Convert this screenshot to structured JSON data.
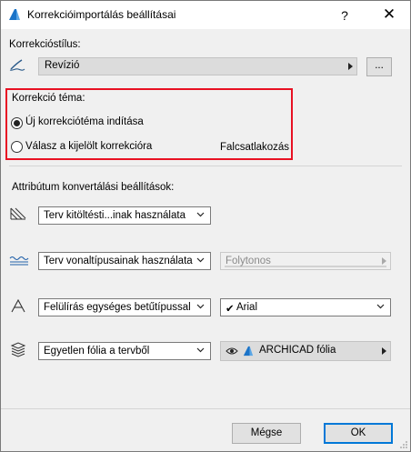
{
  "window": {
    "title": "Korrekcióimportálás beállításai",
    "help_label": "?",
    "close_label": "✕"
  },
  "style_section": {
    "label": "Korrekcióstílus:",
    "value": "Revízió",
    "browse_label": "..."
  },
  "topic_section": {
    "label": "Korrekció téma:",
    "options": [
      {
        "label": "Új korrekciótéma indítása",
        "selected": true
      },
      {
        "label": "Válasz a kijelölt korrekcióra",
        "selected": false
      }
    ],
    "selected_topic": "Falcsatlakozás"
  },
  "attributes": {
    "label": "Attribútum konvertálási beállítások:",
    "fill": {
      "value": "Terv kitöltésti...inak használata"
    },
    "line": {
      "value": "Terv vonaltípusainak használata",
      "secondary": "Folytonos"
    },
    "font": {
      "value": "Felülírás egységes betűtípussal",
      "secondary": "Arial",
      "secondary_prefix": "✔"
    },
    "layer": {
      "value": "Egyetlen fólia a tervből",
      "secondary": "ARCHICAD fólia"
    }
  },
  "buttons": {
    "cancel": "Mégse",
    "ok": "OK"
  },
  "colors": {
    "accent": "#0078d7",
    "highlight": "#e81123",
    "panel": "#f0f0f0"
  }
}
